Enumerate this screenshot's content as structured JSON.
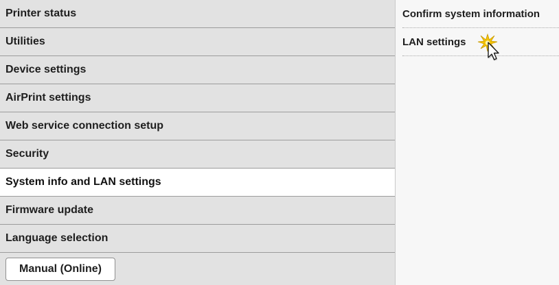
{
  "menu": {
    "items": [
      {
        "label": "Printer status"
      },
      {
        "label": "Utilities"
      },
      {
        "label": "Device settings"
      },
      {
        "label": "AirPrint settings"
      },
      {
        "label": "Web service connection setup"
      },
      {
        "label": "Security"
      },
      {
        "label": "System info and LAN settings",
        "selected": true
      },
      {
        "label": "Firmware update"
      },
      {
        "label": "Language selection"
      }
    ],
    "manual_label": "Manual (Online)"
  },
  "submenu": {
    "items": [
      {
        "label": "Confirm system information"
      },
      {
        "label": "LAN settings"
      }
    ]
  },
  "icons": {
    "cursor": "pointer-cursor-with-click-highlight-icon"
  },
  "colors": {
    "menu_background": "#e2e2e2",
    "selected_background": "#ffffff",
    "panel_background": "#f7f7f7",
    "click_highlight": "#f5c400"
  }
}
